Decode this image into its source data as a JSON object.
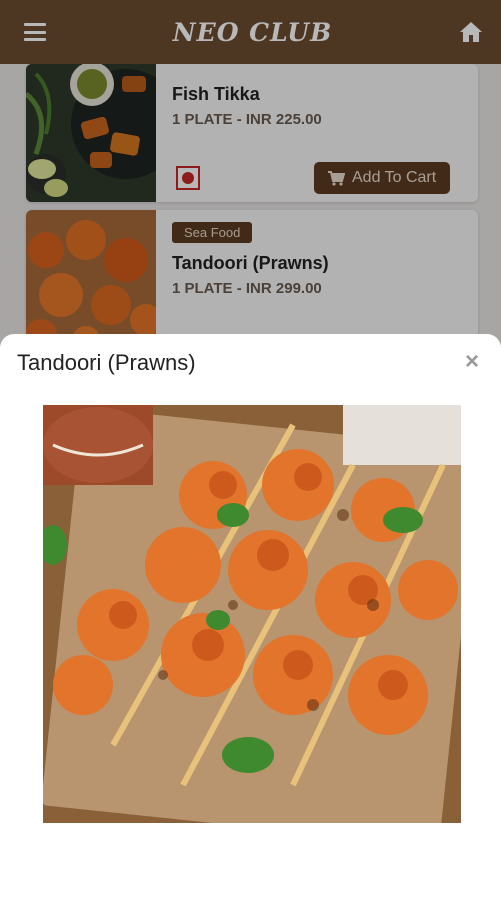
{
  "header": {
    "brand": "NEO CLUB",
    "menu_icon": "hamburger-menu-icon",
    "home_icon": "home-icon",
    "bg_color": "#6b4d31"
  },
  "menu_items": [
    {
      "name": "Fish Tikka",
      "price": "1 PLATE - INR 225.00",
      "add_label": "Add To Cart",
      "type_icon": "non-veg-icon"
    },
    {
      "category": "Sea Food",
      "name": "Tandoori (Prawns)",
      "price": "1 PLATE - INR 299.00"
    }
  ],
  "modal": {
    "title": "Tandoori (Prawns)",
    "close": "×",
    "photo_icon": "prawns-photo"
  },
  "colors": {
    "accent": "#5a3b22",
    "nonveg": "#c62828"
  }
}
